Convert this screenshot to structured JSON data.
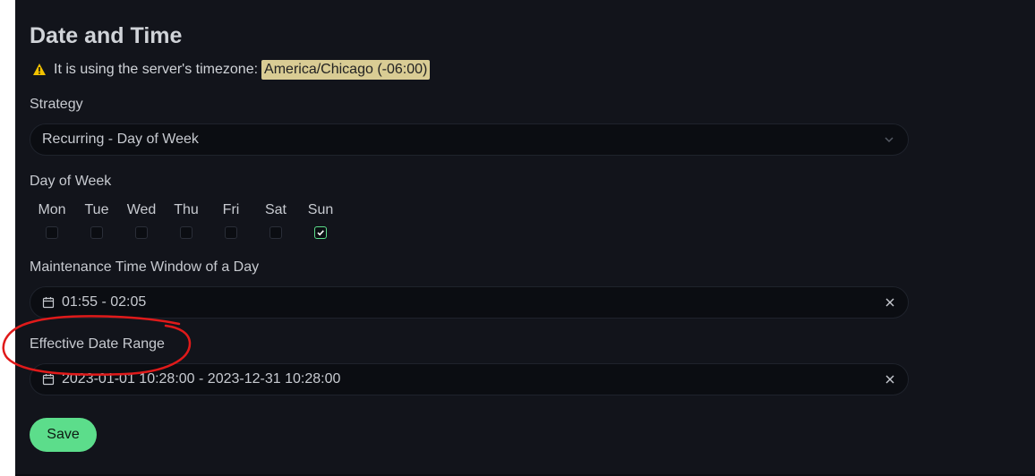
{
  "page": {
    "title": "Date and Time",
    "timezone_notice": "It is using the server's timezone:",
    "timezone_value": "America/Chicago (-06:00)"
  },
  "strategy": {
    "label": "Strategy",
    "selected": "Recurring - Day of Week"
  },
  "day_of_week": {
    "label": "Day of Week",
    "days": [
      {
        "name": "Mon",
        "checked": false
      },
      {
        "name": "Tue",
        "checked": false
      },
      {
        "name": "Wed",
        "checked": false
      },
      {
        "name": "Thu",
        "checked": false
      },
      {
        "name": "Fri",
        "checked": false
      },
      {
        "name": "Sat",
        "checked": false
      },
      {
        "name": "Sun",
        "checked": true
      }
    ]
  },
  "time_window": {
    "label": "Maintenance Time Window of a Day",
    "value": "01:55 - 02:05"
  },
  "date_range": {
    "label": "Effective Date Range",
    "value": "2023-01-01 10:28:00 - 2023-12-31 10:28:00"
  },
  "actions": {
    "save_label": "Save"
  },
  "icons": {
    "warning": "warning-icon",
    "chevron": "chevron-down-icon",
    "calendar": "calendar-icon",
    "clear": "close-icon",
    "check": "checkmark-icon"
  },
  "colors": {
    "panel_bg": "#12141b",
    "field_bg": "#0b0d12",
    "accent": "#5cdd8b",
    "timezone_highlight": "#d9cc94",
    "annotation": "#e01a1a"
  }
}
